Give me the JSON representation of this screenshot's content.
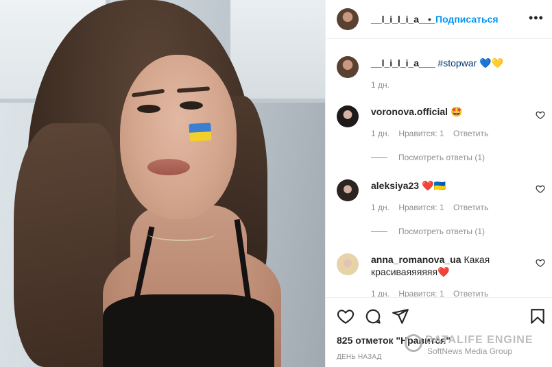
{
  "post": {
    "author": "__l_i_l_i_a___",
    "follow_label": "Подписаться",
    "more_label": "•••",
    "caption_hashtag": "#stopwar",
    "caption_emoji": "💙💛",
    "caption_time": "1 дн."
  },
  "comments": [
    {
      "user": "voronova.official",
      "text": "🤩",
      "time": "1 дн.",
      "likes": "Нравится: 1",
      "reply": "Ответить",
      "replies": "Посмотреть ответы (1)",
      "avatar": "avatar-2"
    },
    {
      "user": "aleksiya23",
      "text": "❤️🇺🇦",
      "time": "1 дн.",
      "likes": "Нравится: 1",
      "reply": "Ответить",
      "replies": "Посмотреть ответы (1)",
      "avatar": "avatar-3"
    },
    {
      "user": "anna_romanova_ua",
      "text_line1": "Какая",
      "text_line2": "красиваяяяяяя❤️",
      "time": "1 дн.",
      "likes": "Нравится: 1",
      "reply": "Ответить",
      "avatar": "avatar-4"
    }
  ],
  "footer": {
    "likes_text": "825 отметок \"Нравится\"",
    "time_text": "День назад"
  },
  "watermark": {
    "title": "DATALIFE ENGINE",
    "subtitle": "SoftNews Media Group"
  },
  "icons": [
    "heart-icon",
    "comment-icon",
    "share-icon",
    "save-icon",
    "more-icon"
  ],
  "colors": {
    "link": "#0095f6",
    "muted": "#8e8e8e",
    "text": "#262626",
    "heart_red": "#ed4956"
  }
}
